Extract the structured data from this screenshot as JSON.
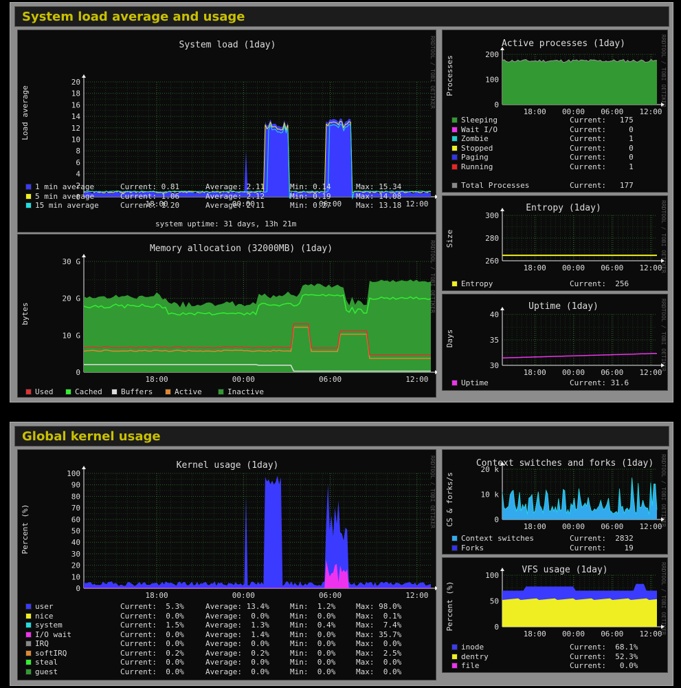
{
  "sections": [
    {
      "title": "System load average and usage"
    },
    {
      "title": "Global kernel usage"
    }
  ],
  "watermark": "RRDTOOL / TOBI OETIKER",
  "x_ticks": [
    "18:00",
    "00:00",
    "06:00",
    "12:00"
  ],
  "colors": {
    "section_title": "#c9c100",
    "grid": "#2b6b2b",
    "background": "#0b0b0b"
  },
  "panels": {
    "load": {
      "title": "System load  (1day)",
      "ylabel": "Load average",
      "yticks": [
        "20",
        "18",
        "16",
        "14",
        "12",
        "10",
        "8",
        "6",
        "4",
        "2",
        "0"
      ],
      "legend": [
        {
          "name": "1 min average",
          "color": "#3b3bff",
          "current": "Current: 0.81",
          "average": "Average: 2.11",
          "min": "Min: 0.14",
          "max": "Max: 15.34"
        },
        {
          "name": "5 min average",
          "color": "#eeee22",
          "current": "Current: 1.06",
          "average": "Average: 2.12",
          "min": "Min: 0.19",
          "max": "Max: 14.08"
        },
        {
          "name": "15 min average",
          "color": "#22dddd",
          "current": "Current: 1.20",
          "average": "Average: 2.11",
          "min": "Min: 0.27",
          "max": "Max: 13.18"
        }
      ],
      "footer": "system uptime: 31 days, 13h 21m"
    },
    "memory": {
      "title": "Memory allocation (32000MB)  (1day)",
      "ylabel": "bytes",
      "yticks": [
        "30 G",
        "20 G",
        "10 G",
        "0"
      ],
      "legend": [
        {
          "name": "Used",
          "color": "#dd3333"
        },
        {
          "name": "Cached",
          "color": "#33ee33"
        },
        {
          "name": "Buffers",
          "color": "#dddddd"
        },
        {
          "name": "Active",
          "color": "#dd8833"
        },
        {
          "name": "Inactive",
          "color": "#339933"
        }
      ]
    },
    "processes": {
      "title": "Active processes  (1day)",
      "ylabel": "Processes",
      "yticks": [
        "200",
        "100",
        "0"
      ],
      "legend": [
        {
          "name": "Sleeping",
          "color": "#339933",
          "current": "Current:   175"
        },
        {
          "name": "Wait I/O",
          "color": "#ee33ee",
          "current": "Current:     0"
        },
        {
          "name": "Zombie",
          "color": "#22cccc",
          "current": "Current:     1"
        },
        {
          "name": "Stopped",
          "color": "#eeee22",
          "current": "Current:     0"
        },
        {
          "name": "Paging",
          "color": "#3333ee",
          "current": "Current:     0"
        },
        {
          "name": "Running",
          "color": "#ee2222",
          "current": "Current:     1"
        }
      ],
      "total": {
        "name": "Total Processes",
        "color": "#888888",
        "current": "Current:   177"
      }
    },
    "entropy": {
      "title": "Entropy  (1day)",
      "ylabel": "Size",
      "yticks": [
        "300",
        "280",
        "260"
      ],
      "legend": [
        {
          "name": "Entropy",
          "color": "#eeee22",
          "current": "Current:  256"
        }
      ]
    },
    "uptime": {
      "title": "Uptime  (1day)",
      "ylabel": "Days",
      "yticks": [
        "40",
        "35",
        "30"
      ],
      "legend": [
        {
          "name": "Uptime",
          "color": "#ee33ee",
          "current": "Current: 31.6"
        }
      ]
    },
    "kernel": {
      "title": "Kernel usage  (1day)",
      "ylabel": "Percent (%)",
      "yticks": [
        "100",
        "90",
        "80",
        "70",
        "60",
        "50",
        "40",
        "30",
        "20",
        "10",
        "0"
      ],
      "legend": [
        {
          "name": "user",
          "color": "#3b3bff",
          "current": "Current:  5.3%",
          "average": "Average: 13.4%",
          "min": "Min:  1.2%",
          "max": "Max: 98.0%"
        },
        {
          "name": "nice",
          "color": "#eeee22",
          "current": "Current:  0.0%",
          "average": "Average:  0.0%",
          "min": "Min:  0.0%",
          "max": "Max:  0.1%"
        },
        {
          "name": "system",
          "color": "#22dddd",
          "current": "Current:  1.5%",
          "average": "Average:  1.3%",
          "min": "Min:  0.4%",
          "max": "Max:  7.4%"
        },
        {
          "name": "I/O wait",
          "color": "#ee33ee",
          "current": "Current:  0.0%",
          "average": "Average:  1.4%",
          "min": "Min:  0.0%",
          "max": "Max: 35.7%"
        },
        {
          "name": "IRQ",
          "color": "#888888",
          "current": "Current:  0.0%",
          "average": "Average:  0.0%",
          "min": "Min:  0.0%",
          "max": "Max:  0.0%"
        },
        {
          "name": "softIRQ",
          "color": "#dd8833",
          "current": "Current:  0.2%",
          "average": "Average:  0.2%",
          "min": "Min:  0.0%",
          "max": "Max:  2.5%"
        },
        {
          "name": "steal",
          "color": "#33ee33",
          "current": "Current:  0.0%",
          "average": "Average:  0.0%",
          "min": "Min:  0.0%",
          "max": "Max:  0.0%"
        },
        {
          "name": "guest",
          "color": "#339933",
          "current": "Current:  0.0%",
          "average": "Average:  0.0%",
          "min": "Min:  0.0%",
          "max": "Max:  0.0%"
        }
      ]
    },
    "context": {
      "title": "Context switches and forks  (1day)",
      "ylabel": "CS & forks/s",
      "yticks": [
        "20 k",
        "10 k",
        "0"
      ],
      "legend": [
        {
          "name": "Context switches",
          "color": "#33aaee",
          "current": "Current:  2832"
        },
        {
          "name": "Forks",
          "color": "#3333ee",
          "current": "Current:    19"
        }
      ]
    },
    "vfs": {
      "title": "VFS usage  (1day)",
      "ylabel": "Percent (%)",
      "yticks": [
        "100",
        "50",
        "0"
      ],
      "legend": [
        {
          "name": "inode",
          "color": "#3b3bff",
          "current": "Current:  68.1%"
        },
        {
          "name": "dentry",
          "color": "#eeee22",
          "current": "Current:  52.3%"
        },
        {
          "name": "file",
          "color": "#ee33ee",
          "current": "Current:   0.0%"
        }
      ]
    }
  }
}
